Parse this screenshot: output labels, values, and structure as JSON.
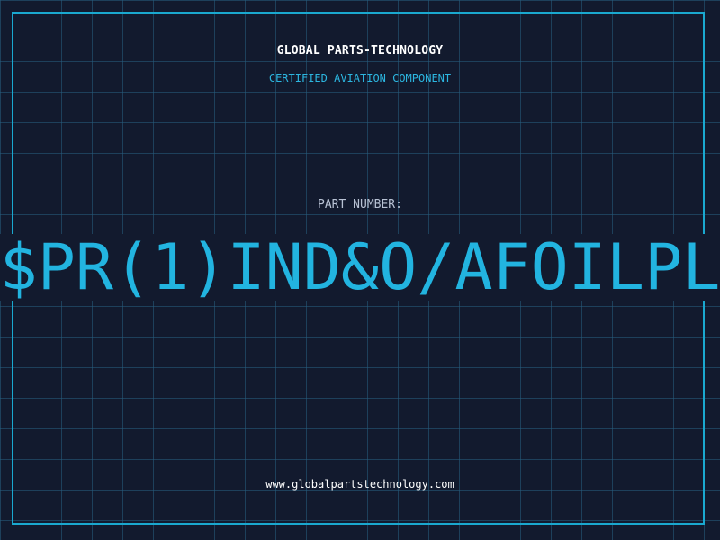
{
  "header": {
    "company": "GLOBAL PARTS-TECHNOLOGY",
    "tagline": "CERTIFIED AVIATION COMPONENT"
  },
  "part": {
    "label": "PART NUMBER:",
    "number": "$PR(1)IND&O/AFOILPL"
  },
  "footer": {
    "website": "www.globalpartstechnology.com"
  },
  "colors": {
    "background": "#121a2e",
    "grid": "#275e80",
    "accent": "#22b4e0",
    "frame": "#1aa8cf"
  }
}
